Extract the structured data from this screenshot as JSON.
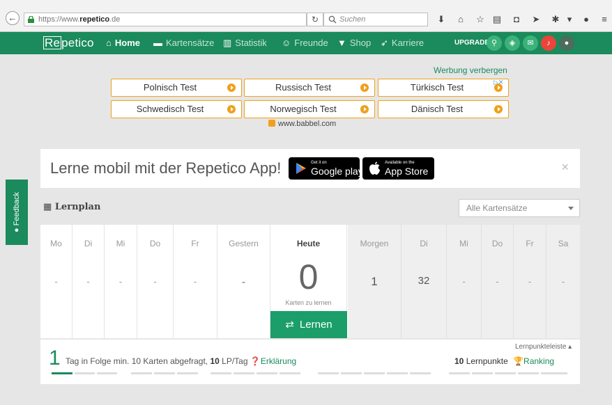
{
  "browser": {
    "url_prefix": "https://www.",
    "url_host": "repetico",
    "url_suffix": ".de",
    "search_placeholder": "Suchen"
  },
  "nav": {
    "logo_boxed": "Re",
    "logo_rest": "petico",
    "items": [
      {
        "label": "Home",
        "icon": "home-icon"
      },
      {
        "label": "Kartensätze",
        "icon": "cards-icon"
      },
      {
        "label": "Statistik",
        "icon": "bar-chart-icon"
      },
      {
        "label": "Freunde",
        "icon": "smile-icon"
      },
      {
        "label": "Shop",
        "icon": "cart-icon"
      },
      {
        "label": "Karriere",
        "icon": "rocket-icon"
      }
    ],
    "upgrade": "UPGRADE"
  },
  "ad": {
    "hide_label": "Werbung verbergen",
    "buttons": [
      "Polnisch Test",
      "Russisch Test",
      "Türkisch Test",
      "Schwedisch Test",
      "Norwegisch Test",
      "Dänisch Test"
    ],
    "source": "www.babbel.com"
  },
  "feedback": "Feedback",
  "app_banner": {
    "text": "Lerne mobil mit der Repetico App!",
    "google_small": "Get it on",
    "google_big": "Google play",
    "apple_small": "Available on the",
    "apple_big": "App Store",
    "close": "×"
  },
  "lernplan": {
    "title": "Lernplan",
    "deck_select": "Alle Kartensätze",
    "past_days": [
      {
        "name": "Mo",
        "value": "-"
      },
      {
        "name": "Di",
        "value": "-"
      },
      {
        "name": "Mi",
        "value": "-"
      },
      {
        "name": "Do",
        "value": "-"
      },
      {
        "name": "Fr",
        "value": "-"
      },
      {
        "name": "Gestern",
        "value": "-"
      }
    ],
    "today": {
      "name": "Heute",
      "count": "0",
      "sub": "Karten zu lernen",
      "button": "Lernen"
    },
    "future_days": [
      {
        "name": "Morgen",
        "value": "1"
      },
      {
        "name": "Di",
        "value": "32"
      },
      {
        "name": "Mi",
        "value": "-"
      },
      {
        "name": "Do",
        "value": "-"
      },
      {
        "name": "Fr",
        "value": "-"
      },
      {
        "name": "Sa",
        "value": "-"
      }
    ]
  },
  "streak": {
    "days": "1",
    "text_pre": "Tag in Folge min. 10 Karten abgefragt,",
    "lp_value": "10",
    "text_post": "LP/Tag",
    "explain": "Erklärung",
    "points_bar_label": "Lernpunkteleiste ▴",
    "points_value": "10",
    "points_label": "Lernpunkte",
    "ranking": "Ranking"
  }
}
